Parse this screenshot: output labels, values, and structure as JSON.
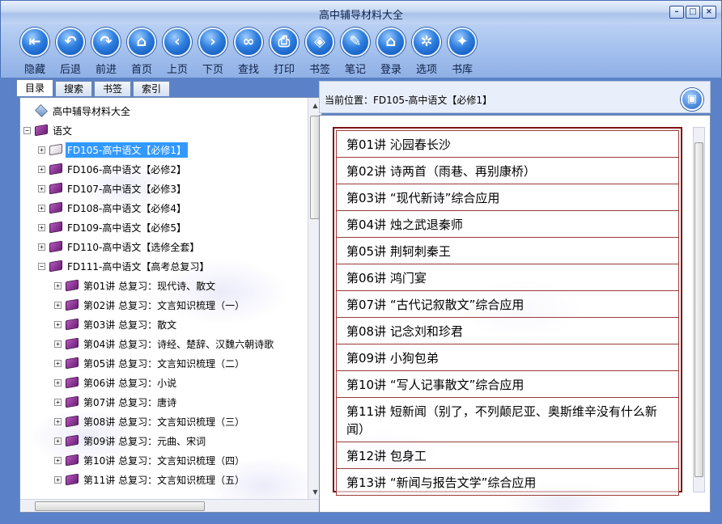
{
  "window": {
    "title": "高中辅导材料大全"
  },
  "toolbar": {
    "buttons": [
      {
        "label": "隐藏",
        "icon": "hide-icon"
      },
      {
        "label": "后退",
        "icon": "back-arrow-icon"
      },
      {
        "label": "前进",
        "icon": "forward-arrow-icon"
      },
      {
        "label": "首页",
        "icon": "home-icon"
      },
      {
        "label": "上页",
        "icon": "chevron-left-icon"
      },
      {
        "label": "下页",
        "icon": "chevron-right-icon"
      },
      {
        "label": "查找",
        "icon": "binoculars-icon"
      },
      {
        "label": "打印",
        "icon": "printer-icon"
      },
      {
        "label": "书签",
        "icon": "bookmark-tag-icon"
      },
      {
        "label": "笔记",
        "icon": "note-icon"
      },
      {
        "label": "登录",
        "icon": "login-house-icon"
      },
      {
        "label": "选项",
        "icon": "gear-icon"
      },
      {
        "label": "书库",
        "icon": "library-icon"
      }
    ]
  },
  "left_tabs": [
    "目录",
    "搜索",
    "书签",
    "索引"
  ],
  "tree": {
    "root": "高中辅导材料大全",
    "subject": "语文",
    "items": [
      {
        "label": "FD105-高中语文【必修1】",
        "selected": true
      },
      {
        "label": "FD106-高中语文【必修2】"
      },
      {
        "label": "FD107-高中语文【必修3】"
      },
      {
        "label": "FD108-高中语文【必修4】"
      },
      {
        "label": "FD109-高中语文【必修5】"
      },
      {
        "label": "FD110-高中语文【选修全套】"
      },
      {
        "label": "FD111-高中语文【高考总复习】",
        "expanded": true
      }
    ],
    "subitems": [
      "第01讲 总复习：现代诗、散文",
      "第02讲 总复习：文言知识梳理（一）",
      "第03讲 总复习：散文",
      "第04讲 总复习：诗经、楚辞、汉魏六朝诗歌",
      "第05讲 总复习：文言知识梳理（二）",
      "第06讲 总复习：小说",
      "第07讲 总复习：唐诗",
      "第08讲 总复习：文言知识梳理（三）",
      "第09讲 总复习：元曲、宋词",
      "第10讲 总复习：文言知识梳理（四）",
      "第11讲 总复习：文言知识梳理（五）"
    ]
  },
  "location": {
    "label": "当前位置：",
    "value": "FD105-高中语文【必修1】"
  },
  "lessons": [
    "第01讲 沁园春长沙",
    "第02讲 诗两首（雨巷、再别康桥）",
    "第03讲 “现代新诗”综合应用",
    "第04讲 烛之武退秦师",
    "第05讲 荆轲刺秦王",
    "第06讲 鸿门宴",
    "第07讲 “古代记叙散文”综合应用",
    "第08讲 记念刘和珍君",
    "第09讲 小狗包弟",
    "第10讲 “写人记事散文”综合应用",
    "第11讲 短新闻（别了，不列颠尼亚、奥斯维辛没有什么新闻）",
    "第12讲 包身工",
    "第13讲 “新闻与报告文学”综合应用"
  ]
}
